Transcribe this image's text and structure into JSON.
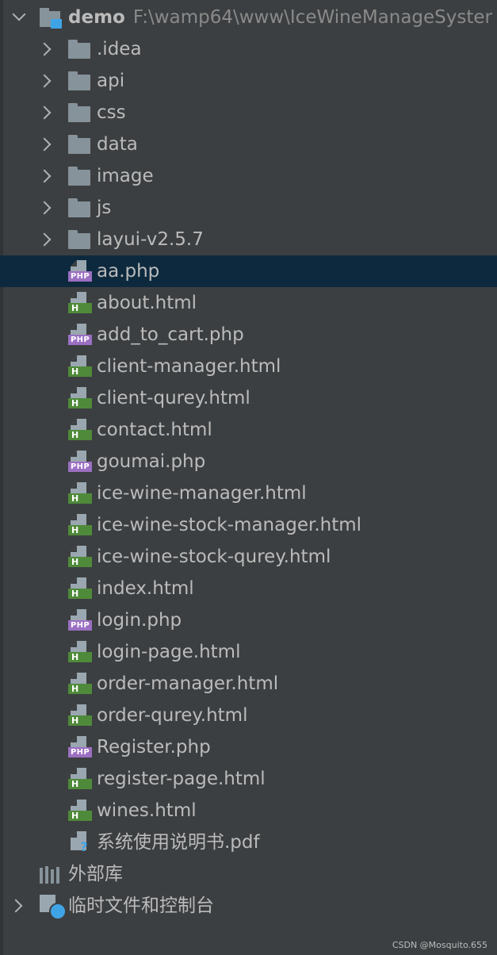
{
  "project": {
    "root_name": "demo",
    "root_path": "F:\\wamp64\\www\\IceWineManageSyster"
  },
  "folders": [
    ".idea",
    "api",
    "css",
    "data",
    "image",
    "js",
    "layui-v2.5.7"
  ],
  "files": [
    {
      "name": "aa.php",
      "type": "php",
      "icon": "php-file-icon"
    },
    {
      "name": "about.html",
      "type": "html",
      "icon": "html-file-icon"
    },
    {
      "name": "add_to_cart.php",
      "type": "php",
      "icon": "php-file-icon"
    },
    {
      "name": "client-manager.html",
      "type": "html",
      "icon": "html-file-icon"
    },
    {
      "name": "client-qurey.html",
      "type": "html",
      "icon": "html-file-icon"
    },
    {
      "name": "contact.html",
      "type": "html",
      "icon": "html-file-icon"
    },
    {
      "name": "goumai.php",
      "type": "php",
      "icon": "php-file-icon"
    },
    {
      "name": "ice-wine-manager.html",
      "type": "html",
      "icon": "html-file-icon"
    },
    {
      "name": "ice-wine-stock-manager.html",
      "type": "html",
      "icon": "html-file-icon"
    },
    {
      "name": "ice-wine-stock-qurey.html",
      "type": "html",
      "icon": "html-file-icon"
    },
    {
      "name": "index.html",
      "type": "html",
      "icon": "html-file-icon"
    },
    {
      "name": "login.php",
      "type": "php",
      "icon": "php-file-icon"
    },
    {
      "name": "login-page.html",
      "type": "html",
      "icon": "html-file-icon"
    },
    {
      "name": "order-manager.html",
      "type": "html",
      "icon": "html-file-icon"
    },
    {
      "name": "order-qurey.html",
      "type": "html",
      "icon": "html-file-icon"
    },
    {
      "name": "Register.php",
      "type": "php",
      "icon": "php-file-icon"
    },
    {
      "name": "register-page.html",
      "type": "html",
      "icon": "html-file-icon"
    },
    {
      "name": "wines.html",
      "type": "html",
      "icon": "html-file-icon"
    },
    {
      "name": "系统使用说明书.pdf",
      "type": "unknown",
      "icon": "unknown-file-icon"
    }
  ],
  "selected_file": "aa.php",
  "external_libraries": "外部库",
  "scratches": "临时文件和控制台",
  "badges": {
    "php": "PHP",
    "html": "H",
    "help": "?"
  },
  "watermark": "CSDN @Mosquito.655",
  "colors": {
    "background": "#3c3f41",
    "selected_row": "#0d293e",
    "folder": "#87939a",
    "php_badge": "#9b6fc1",
    "html_badge": "#4f8a3a",
    "accent_blue": "#3fa4e6"
  }
}
